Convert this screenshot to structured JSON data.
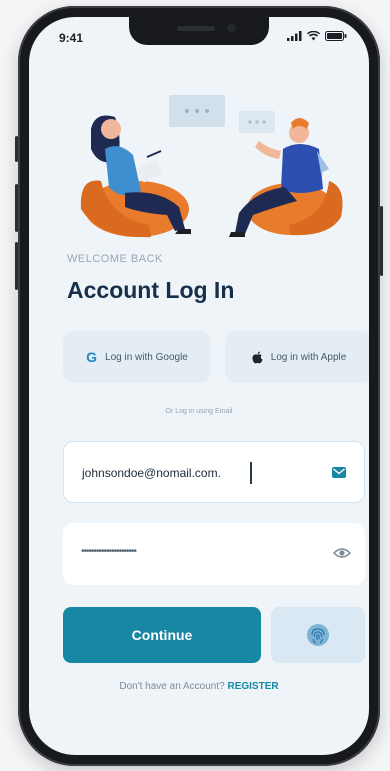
{
  "status_bar": {
    "time": "9:41"
  },
  "welcome": "WELCOME BACK",
  "title": "Account Log In",
  "social": {
    "google_label": "Log in with Google",
    "apple_label": "Log in with Apple"
  },
  "divider_text": "Or Log in using Email",
  "email": {
    "value": "johnsondoe@nomail.com."
  },
  "password": {
    "masked_value": "••••••••••••••••••••••"
  },
  "actions": {
    "continue_label": "Continue"
  },
  "register": {
    "prompt": "Don't have an Account?",
    "link": "REGISTER"
  },
  "colors": {
    "accent": "#1887a3",
    "title": "#17304a",
    "chair": "#e87b2c"
  }
}
